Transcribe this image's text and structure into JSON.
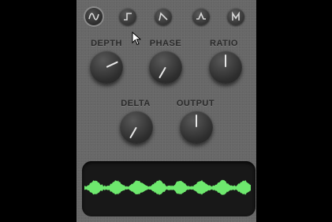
{
  "wave_buttons": [
    {
      "icon": "sine-wave-icon"
    },
    {
      "icon": "square-wave-icon"
    },
    {
      "icon": "sawtooth-wave-icon"
    },
    {
      "icon": "triangle-wave-icon"
    },
    {
      "icon": "m-shape-wave-icon"
    }
  ],
  "knobs": {
    "depth": {
      "label": "DEPTH"
    },
    "phase": {
      "label": "PHASE"
    },
    "ratio": {
      "label": "RATIO"
    },
    "delta": {
      "label": "DELTA"
    },
    "output": {
      "label": "OUTPUT"
    }
  },
  "colors": {
    "panel": "#676767",
    "knob": "#2e2e2e",
    "label": "#2a2a2a",
    "waveform": "#6ee86e",
    "display": "#181818"
  }
}
